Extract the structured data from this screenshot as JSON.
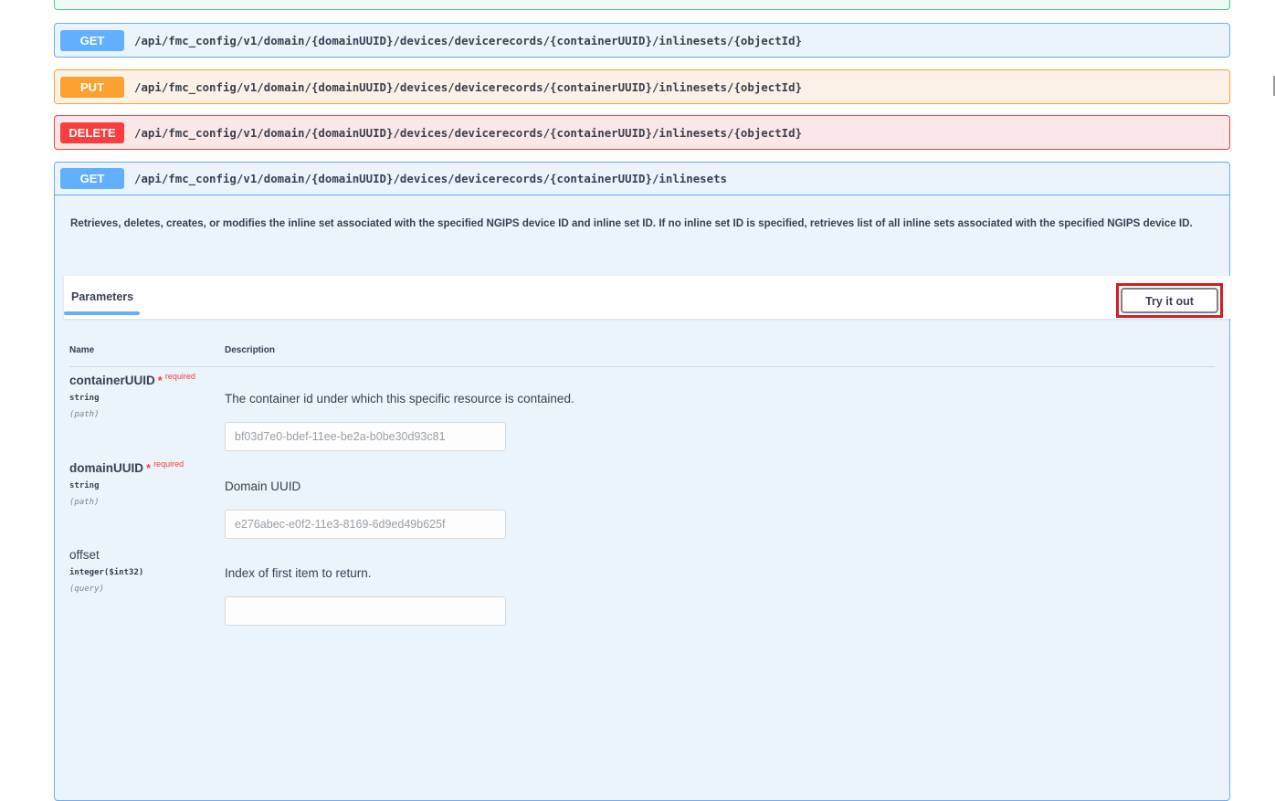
{
  "operations": [
    {
      "method": "GET",
      "path": "/api/fmc_config/v1/domain/{domainUUID}/devices/devicerecords/{containerUUID}/inlinesets/{objectId}"
    },
    {
      "method": "PUT",
      "path": "/api/fmc_config/v1/domain/{domainUUID}/devices/devicerecords/{containerUUID}/inlinesets/{objectId}"
    },
    {
      "method": "DELETE",
      "path": "/api/fmc_config/v1/domain/{domainUUID}/devices/devicerecords/{containerUUID}/inlinesets/{objectId}"
    },
    {
      "method": "GET",
      "path": "/api/fmc_config/v1/domain/{domainUUID}/devices/devicerecords/{containerUUID}/inlinesets"
    }
  ],
  "expanded": {
    "description": "Retrieves, deletes, creates, or modifies the inline set associated with the specified NGIPS device ID and inline set ID. If no inline set ID is specified, retrieves list of all inline sets associated with the specified NGIPS device ID.",
    "parameters_tab": "Parameters",
    "try_it_out_label": "Try it out",
    "table_headers": {
      "name": "Name",
      "description": "Description"
    },
    "parameters": [
      {
        "name": "containerUUID",
        "required_star": "*",
        "required_label": "required",
        "type": "string",
        "in": "(path)",
        "description": "The container id under which this specific resource is contained.",
        "value": "bf03d7e0-bdef-11ee-be2a-b0be30d93c81"
      },
      {
        "name": "domainUUID",
        "required_star": "*",
        "required_label": "required",
        "type": "string",
        "in": "(path)",
        "description": "Domain UUID",
        "value": "e276abec-e0f2-11e3-8169-6d9ed49b625f"
      },
      {
        "name": "offset",
        "type": "integer($int32)",
        "in": "(query)",
        "description": "Index of first item to return."
      }
    ]
  },
  "colors": {
    "get": "#61affe",
    "put": "#fca130",
    "delete": "#f93e3e",
    "highlight": "#d61b25"
  }
}
